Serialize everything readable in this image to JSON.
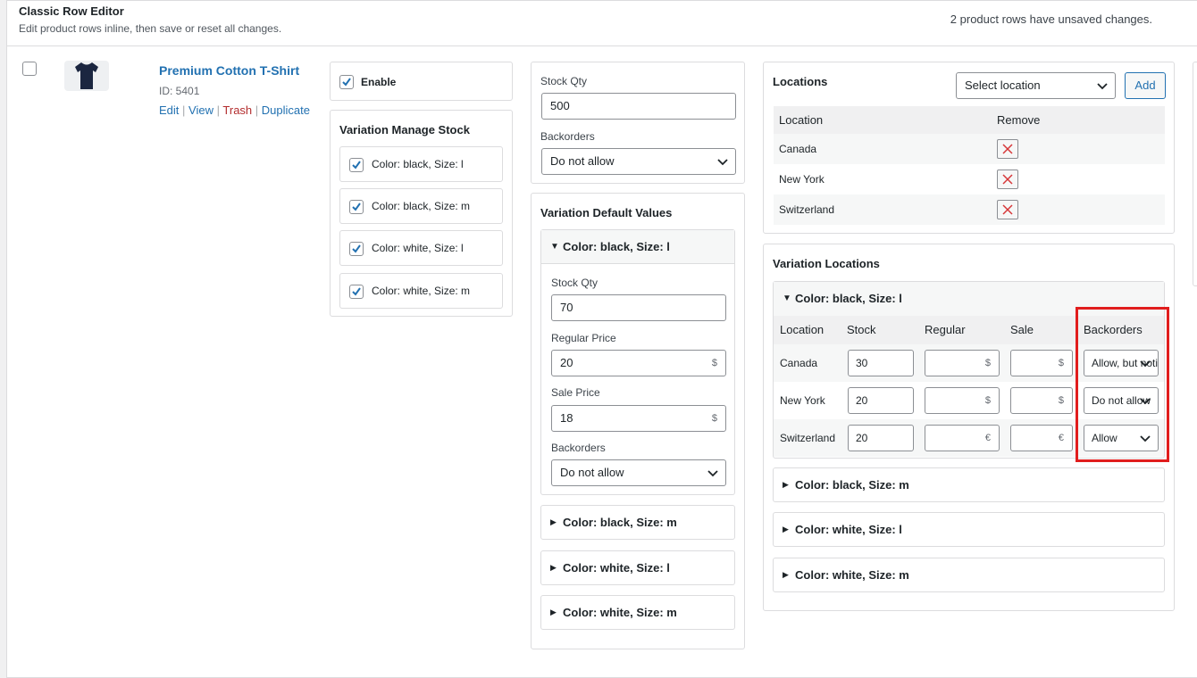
{
  "header": {
    "title": "Classic Row Editor",
    "subtitle": "Edit product rows inline, then save or reset all changes.",
    "unsaved_notice": "2 product rows have unsaved changes."
  },
  "product": {
    "name": "Premium Cotton T-Shirt",
    "id_text": "ID: 5401",
    "actions": {
      "edit": "Edit",
      "view": "View",
      "trash": "Trash",
      "duplicate": "Duplicate",
      "separator": "|"
    },
    "thumbnail_icon": "tshirt-icon"
  },
  "enable": {
    "label": "Enable",
    "checked": true
  },
  "variation_manage_stock": {
    "title": "Variation Manage Stock",
    "items": [
      {
        "label": "Color: black, Size: l",
        "checked": true
      },
      {
        "label": "Color: black, Size: m",
        "checked": true
      },
      {
        "label": "Color: white, Size: l",
        "checked": true
      },
      {
        "label": "Color: white, Size: m",
        "checked": true
      }
    ]
  },
  "stock": {
    "qty_label": "Stock Qty",
    "qty_value": "500",
    "backorders_label": "Backorders",
    "backorders_value": "Do not allow"
  },
  "variation_defaults": {
    "title": "Variation Default Values",
    "expanded": {
      "header": "Color: black, Size: l",
      "stock_label": "Stock Qty",
      "stock_value": "70",
      "regular_label": "Regular Price",
      "regular_value": "20",
      "sale_label": "Sale Price",
      "sale_value": "18",
      "currency": "$",
      "backorders_label": "Backorders",
      "backorders_value": "Do not allow"
    },
    "collapsed": [
      "Color: black, Size: m",
      "Color: white, Size: l",
      "Color: white, Size: m"
    ]
  },
  "locations": {
    "title": "Locations",
    "select_placeholder": "Select location",
    "add_label": "Add",
    "columns": {
      "location": "Location",
      "remove": "Remove"
    },
    "rows": [
      "Canada",
      "New York",
      "Switzerland"
    ]
  },
  "variation_locations": {
    "title": "Variation Locations",
    "expanded_header": "Color: black, Size: l",
    "columns": {
      "location": "Location",
      "stock": "Stock",
      "regular": "Regular",
      "sale": "Sale",
      "backorders": "Backorders"
    },
    "rows": [
      {
        "location": "Canada",
        "stock": "30",
        "currency": "$",
        "backorders": "Allow, but notify"
      },
      {
        "location": "New York",
        "stock": "20",
        "currency": "$",
        "backorders": "Do not allow"
      },
      {
        "location": "Switzerland",
        "stock": "20",
        "currency": "€",
        "backorders": "Allow"
      }
    ],
    "collapsed": [
      "Color: black, Size: m",
      "Color: white, Size: l",
      "Color: white, Size: m"
    ]
  },
  "colors": {
    "link": "#2271b1",
    "trash": "#b32d2e",
    "highlight": "#e11d1d",
    "checkbox": "#2271b1",
    "remove_x": "#d63638"
  },
  "glyphs": {
    "expanded": "▼",
    "collapsed": "▶"
  }
}
